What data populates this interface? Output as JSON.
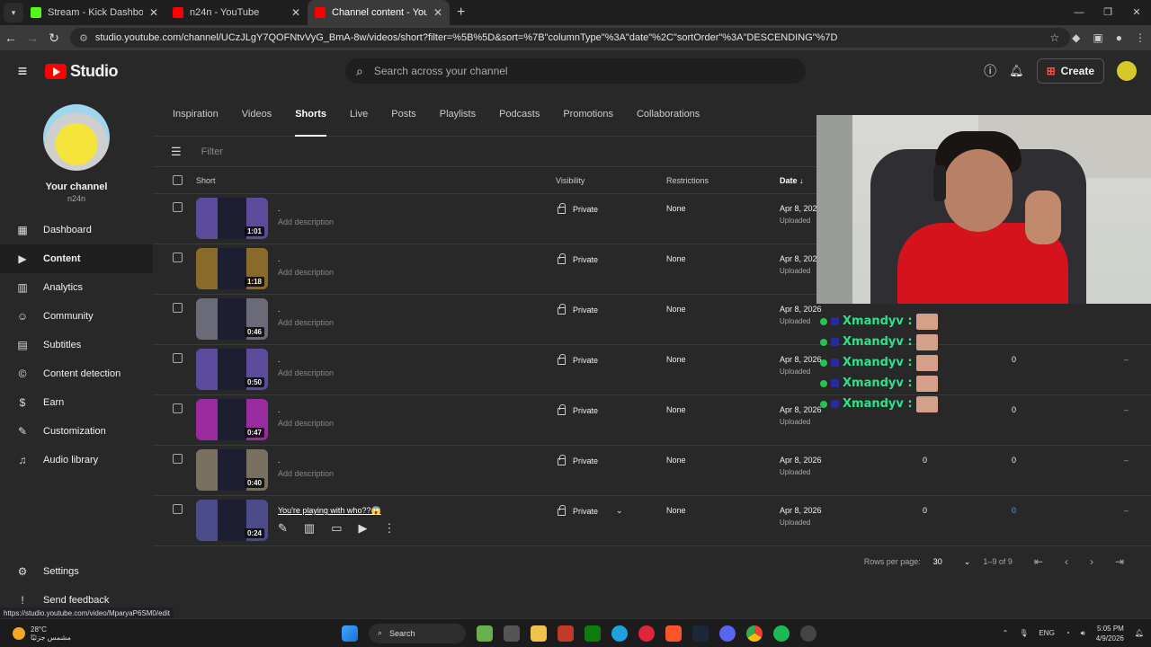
{
  "browser": {
    "tabs": [
      {
        "title": "Stream - Kick Dashboard",
        "color": "#53fc18"
      },
      {
        "title": "n24n - YouTube",
        "color": "#ff0000"
      },
      {
        "title": "Channel content - YouTube Stu",
        "color": "#ff0000"
      }
    ],
    "url": "studio.youtube.com/channel/UCzJLgY7QOFNtvVyG_BmA-8w/videos/short?filter=%5B%5D&sort=%7B\"columnType\"%3A\"date\"%2C\"sortOrder\"%3A\"DESCENDING\"%7D",
    "status_url": "https://studio.youtube.com/video/MparyaP6SM0/edit"
  },
  "header": {
    "logo_text": "Studio",
    "search_placeholder": "Search across your channel",
    "create_label": "Create"
  },
  "sidebar": {
    "channel_title": "Your channel",
    "channel_handle": "n24n",
    "items": [
      {
        "label": "Dashboard",
        "icon": "dashboard-icon"
      },
      {
        "label": "Content",
        "icon": "content-icon"
      },
      {
        "label": "Analytics",
        "icon": "analytics-icon"
      },
      {
        "label": "Community",
        "icon": "community-icon"
      },
      {
        "label": "Subtitles",
        "icon": "subtitles-icon"
      },
      {
        "label": "Content detection",
        "icon": "copyright-icon"
      },
      {
        "label": "Earn",
        "icon": "dollar-icon"
      },
      {
        "label": "Customization",
        "icon": "wand-icon"
      },
      {
        "label": "Audio library",
        "icon": "music-icon"
      }
    ],
    "settings": "Settings",
    "feedback": "Send feedback"
  },
  "content_tabs": [
    "Inspiration",
    "Videos",
    "Shorts",
    "Live",
    "Posts",
    "Playlists",
    "Podcasts",
    "Promotions",
    "Collaborations"
  ],
  "filter_placeholder": "Filter",
  "table": {
    "headers": {
      "short": "Short",
      "visibility": "Visibility",
      "restrictions": "Restrictions",
      "date": "Date"
    },
    "rows": [
      {
        "title": ".",
        "desc": "Add description",
        "duration": "1:01",
        "visibility": "Private",
        "restrictions": "None",
        "date": "Apr 8, 2026",
        "status": "Uploaded",
        "v1": "",
        "v2": "",
        "v3": "",
        "thumb": "#5b4b9a"
      },
      {
        "title": ".",
        "desc": "Add description",
        "duration": "1:18",
        "visibility": "Private",
        "restrictions": "None",
        "date": "Apr 8, 2026",
        "status": "Uploaded",
        "v1": "",
        "v2": "",
        "v3": "",
        "thumb": "#8a6a2a"
      },
      {
        "title": ".",
        "desc": "Add description",
        "duration": "0:46",
        "visibility": "Private",
        "restrictions": "None",
        "date": "Apr 8, 2026",
        "status": "Uploaded",
        "v1": "",
        "v2": "",
        "v3": "",
        "thumb": "#6a6a78"
      },
      {
        "title": ".",
        "desc": "Add description",
        "duration": "0:50",
        "visibility": "Private",
        "restrictions": "None",
        "date": "Apr 8, 2026",
        "status": "Uploaded",
        "v1": "",
        "v2": "0",
        "v3": "–",
        "thumb": "#5b4b9a"
      },
      {
        "title": ".",
        "desc": "Add description",
        "duration": "0:47",
        "visibility": "Private",
        "restrictions": "None",
        "date": "Apr 8, 2026",
        "status": "Uploaded",
        "v1": "",
        "v2": "0",
        "v3": "–",
        "thumb": "#9a2aa0"
      },
      {
        "title": ".",
        "desc": "Add description",
        "duration": "0:40",
        "visibility": "Private",
        "restrictions": "None",
        "date": "Apr 8, 2026",
        "status": "Uploaded",
        "v1": "0",
        "v2": "0",
        "v3": "–",
        "thumb": "#7a7060"
      },
      {
        "title": "You're playing with who??😱",
        "desc": "",
        "duration": "0:24",
        "visibility": "Private",
        "restrictions": "None",
        "date": "Apr 8, 2026",
        "status": "Uploaded",
        "v1": "0",
        "v2": "0",
        "v3": "–",
        "thumb": "#4b4b8a"
      }
    ]
  },
  "pagination": {
    "rows_label": "Rows per page:",
    "rows_value": "30",
    "range": "1–9 of 9"
  },
  "chat": {
    "name": "Xmandyv :",
    "count": 5
  },
  "taskbar": {
    "temp": "28°C",
    "weather_desc": "مشمس جزئيًا",
    "search": "Search",
    "lang": "ENG",
    "time": "5:05 PM",
    "date": "4/9/2026"
  }
}
